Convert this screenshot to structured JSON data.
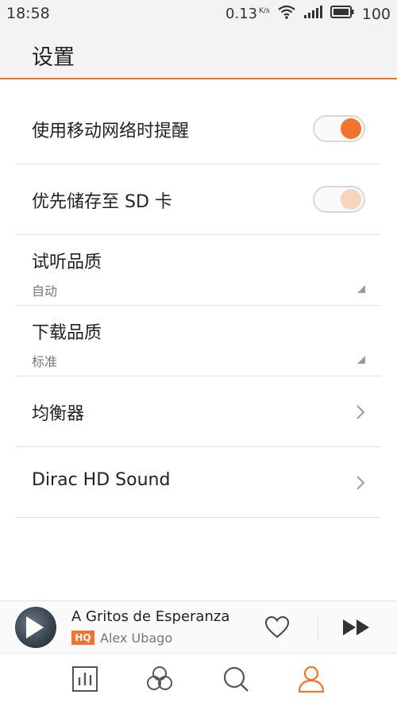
{
  "status_bar": {
    "time": "18:58",
    "network_speed": "0.13",
    "speed_unit": "K/s",
    "battery": "100"
  },
  "header": {
    "title": "设置"
  },
  "settings": {
    "mobile_network_reminder": {
      "label": "使用移动网络时提醒",
      "enabled": true
    },
    "prefer_sd_storage": {
      "label": "优先储存至 SD 卡",
      "enabled": true
    },
    "listen_quality": {
      "label": "试听品质",
      "value": "自动"
    },
    "download_quality": {
      "label": "下载品质",
      "value": "标准"
    },
    "equalizer": {
      "label": "均衡器"
    },
    "dirac": {
      "label": "Dirac HD Sound"
    }
  },
  "player": {
    "song_title": "A Gritos de Esperanza",
    "quality_badge": "HQ",
    "artist": "Alex Ubago"
  },
  "bottom_nav": {
    "items": [
      "chart-icon",
      "circles-icon",
      "search-icon",
      "profile-icon"
    ],
    "active": "profile-icon"
  },
  "colors": {
    "accent": "#f0742c",
    "accent_dim": "#f8d3bd",
    "text": "#222222",
    "subtext": "#777777"
  }
}
